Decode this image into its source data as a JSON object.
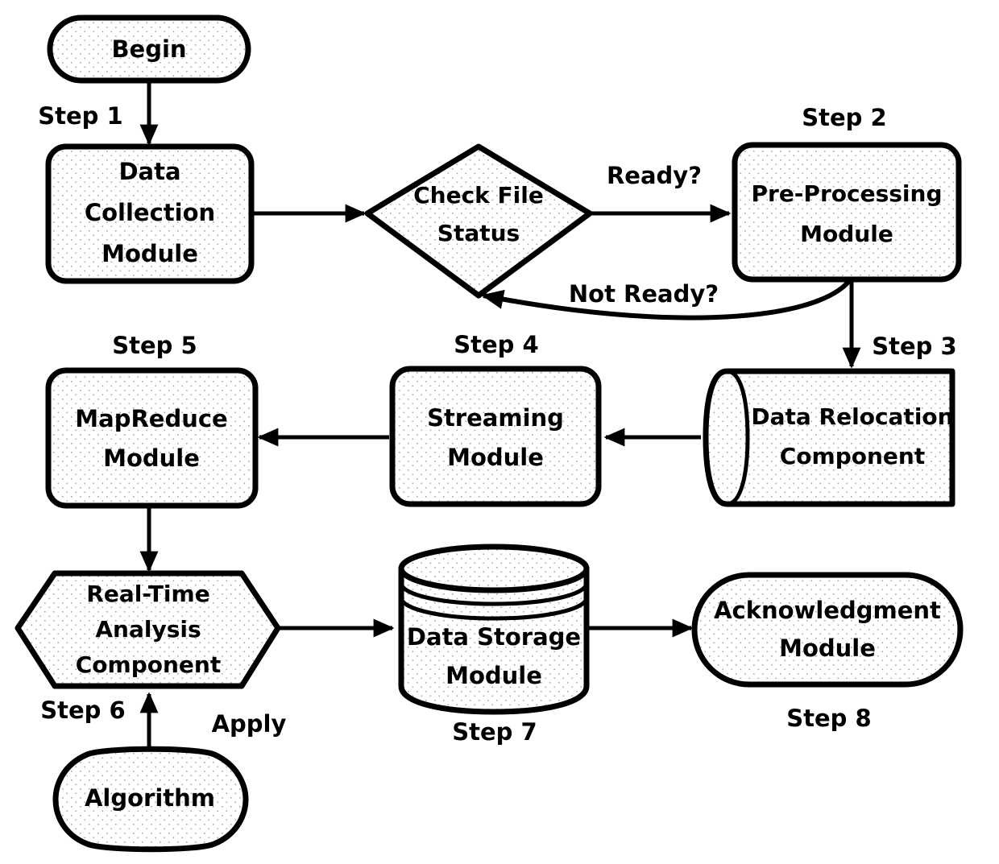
{
  "diagram": {
    "title": "Big Data Processing Flowchart",
    "background_color": "#ffffff",
    "stroke_color": "#000000",
    "fill_pattern": "stipple-dots",
    "nodes": [
      {
        "id": "begin",
        "label": "Begin",
        "shape": "stadium"
      },
      {
        "id": "data_collection",
        "label_lines": [
          "Data",
          "Collection",
          "Module"
        ],
        "shape": "rounded-rect"
      },
      {
        "id": "check_file",
        "label_lines": [
          "Check File",
          "Status"
        ],
        "shape": "diamond"
      },
      {
        "id": "preprocessing",
        "label_lines": [
          "Pre-Processing",
          "Module"
        ],
        "shape": "rounded-rect"
      },
      {
        "id": "data_relocation",
        "label_lines": [
          "Data Relocation",
          "Component"
        ],
        "shape": "cylinder-horizontal"
      },
      {
        "id": "streaming",
        "label_lines": [
          "Streaming",
          "Module"
        ],
        "shape": "rounded-rect"
      },
      {
        "id": "mapreduce",
        "label_lines": [
          "MapReduce",
          "Module"
        ],
        "shape": "rounded-rect"
      },
      {
        "id": "realtime",
        "label_lines": [
          "Real-Time",
          "Analysis",
          "Component"
        ],
        "shape": "hexagon"
      },
      {
        "id": "data_storage",
        "label_lines": [
          "Data Storage",
          "Module"
        ],
        "shape": "cylinder-vertical"
      },
      {
        "id": "acknowledgment",
        "label_lines": [
          "Acknowledgment",
          "Module"
        ],
        "shape": "stadium"
      },
      {
        "id": "algorithm",
        "label": "Algorithm",
        "shape": "ellipse"
      }
    ],
    "step_labels": [
      {
        "id": "step1",
        "text": "Step 1"
      },
      {
        "id": "step2",
        "text": "Step 2"
      },
      {
        "id": "step3",
        "text": "Step 3"
      },
      {
        "id": "step4",
        "text": "Step 4"
      },
      {
        "id": "step5",
        "text": "Step 5"
      },
      {
        "id": "step6",
        "text": "Step 6"
      },
      {
        "id": "step7",
        "text": "Step 7"
      },
      {
        "id": "step8",
        "text": "Step 8"
      }
    ],
    "edge_labels": [
      {
        "id": "ready",
        "text": "Ready?"
      },
      {
        "id": "not_ready",
        "text": "Not Ready?"
      },
      {
        "id": "apply",
        "text": "Apply"
      }
    ]
  }
}
